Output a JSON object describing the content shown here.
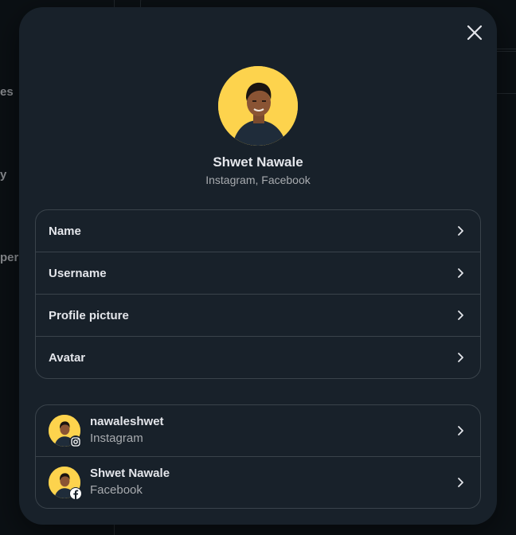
{
  "background": {
    "fragments": [
      "es",
      "y",
      "per"
    ]
  },
  "profile": {
    "name": "Shwet Nawale",
    "platforms": "Instagram, Facebook"
  },
  "settings": {
    "items": [
      {
        "label": "Name"
      },
      {
        "label": "Username"
      },
      {
        "label": "Profile picture"
      },
      {
        "label": "Avatar"
      }
    ]
  },
  "accounts": [
    {
      "username": "nawaleshwet",
      "platform": "Instagram",
      "badge_icon": "instagram-icon"
    },
    {
      "username": "Shwet Nawale",
      "platform": "Facebook",
      "badge_icon": "facebook-icon"
    }
  ],
  "colors": {
    "modal_bg": "#18212a",
    "page_bg": "#0b1014",
    "border": "#3a434b",
    "avatar_bg": "#fdd34d"
  }
}
